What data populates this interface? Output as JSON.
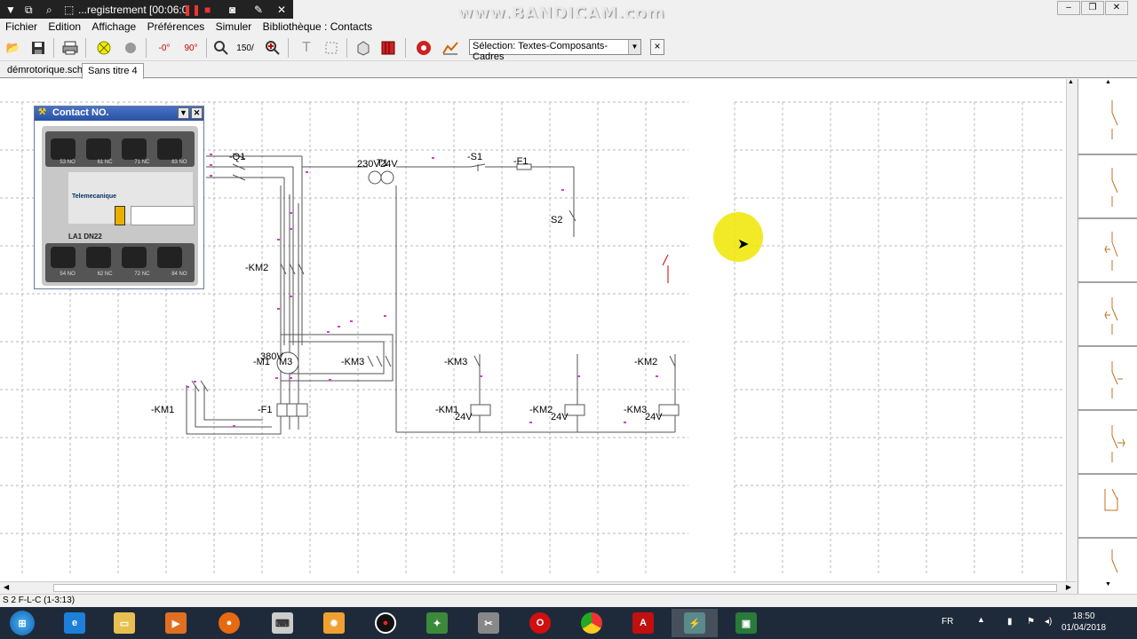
{
  "recorder": {
    "title": "...registrement [00:06:0",
    "watermark": "www.BANDICAM.com"
  },
  "menu": [
    "Fichier",
    "Edition",
    "Affichage",
    "Préférences",
    "Simuler",
    "Bibliothèque : Contacts"
  ],
  "toolbar": {
    "rot_minus": "-0°",
    "rot_90": "90°",
    "zoom": "150/",
    "selection_value": "Sélection: Textes-Composants-Cadres",
    "close": "×"
  },
  "tabs": [
    "démrotorique.sch",
    "Sans titre 4"
  ],
  "contact_window": {
    "title": "Contact NO.",
    "brand": "Telemecanique",
    "model": "LA1 DN22",
    "top_terminals": [
      "53 NO",
      "61 NC",
      "71 NC",
      "83 NO"
    ],
    "bottom_terminals": [
      "54 NO",
      "62 NC",
      "72 NC",
      "84 NO"
    ]
  },
  "schematic_labels": {
    "q1": "-Q1",
    "t1": "T1",
    "v230": "230V",
    "v24": "24V",
    "s1": "-S1",
    "f1_top": "-F1",
    "s2": "S2",
    "km2_left": "-KM2",
    "m1": "-M1",
    "v380": "380V",
    "m3": "M3",
    "km3_mid": "-KM3",
    "km3_right": "-KM3",
    "km2_right": "-KM2",
    "km1_left": "-KM1",
    "f1_bottom": "-F1",
    "km1_coil": "-KM1",
    "km2_coil": "-KM2",
    "km3_coil": "-KM3",
    "coil_v": "24V"
  },
  "status": "S 2  F-L-C (1-3:13)",
  "tray": {
    "lang": "FR",
    "time": "18:50",
    "date": "01/04/2018"
  }
}
